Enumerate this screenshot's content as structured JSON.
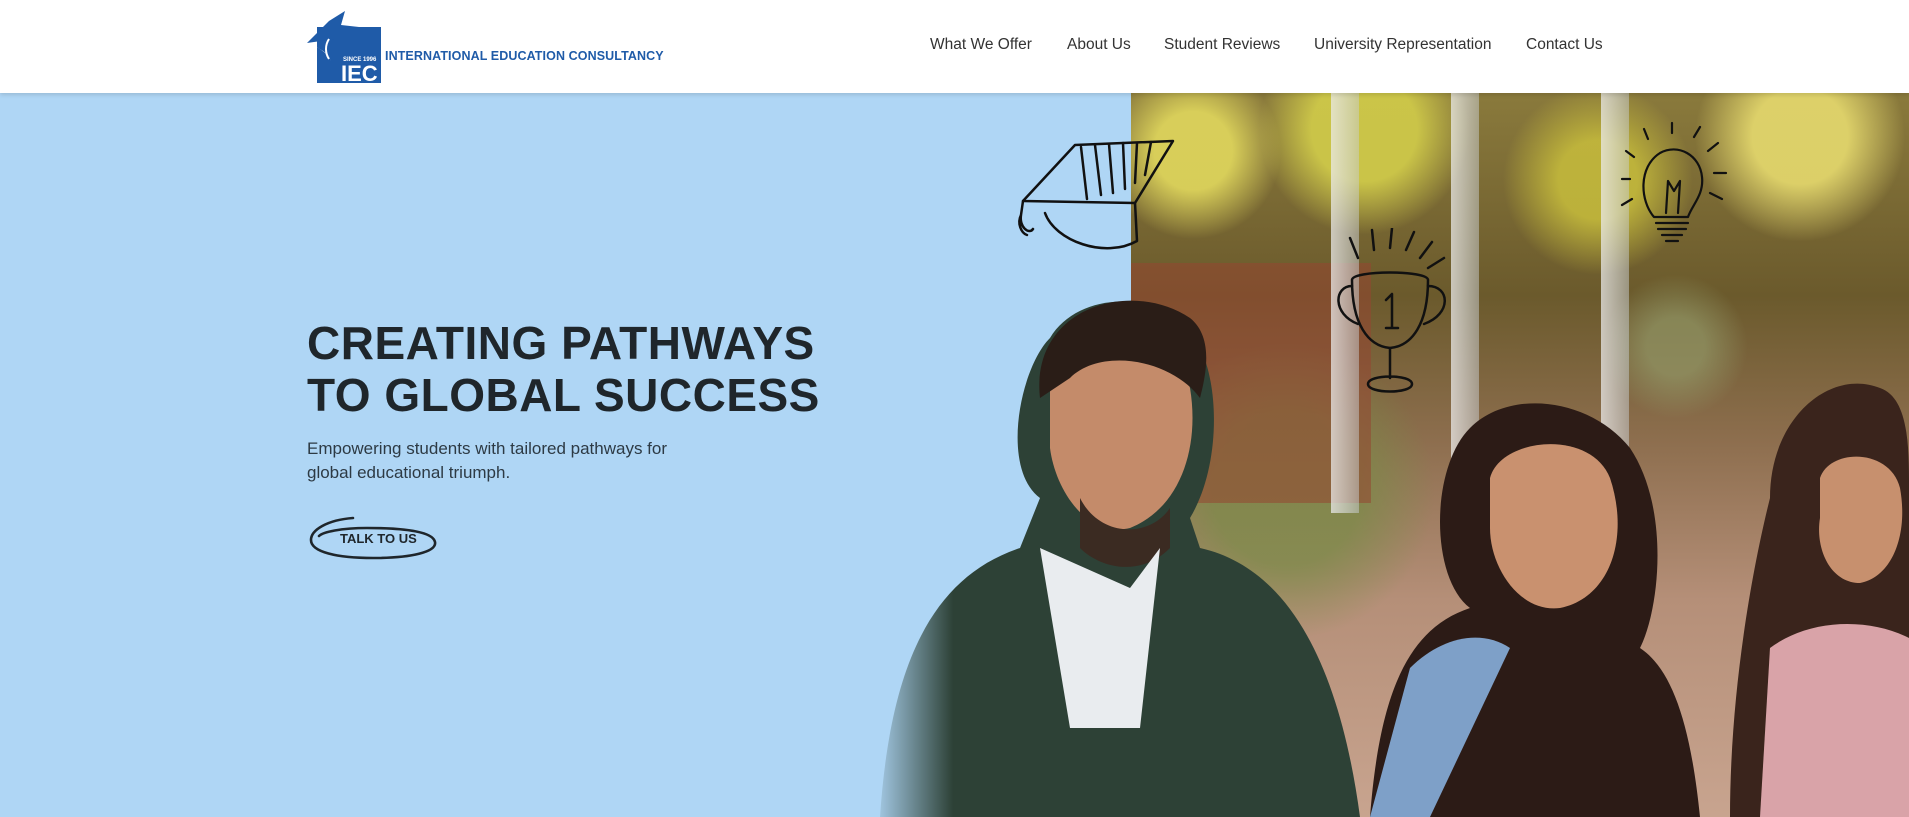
{
  "brand": {
    "since_text": "SINCE 1996",
    "monogram": "IEC",
    "name": "INTERNATIONAL EDUCATION CONSULTANCY",
    "color": "#1f5ba8"
  },
  "nav": {
    "items": [
      {
        "label": "What We Offer"
      },
      {
        "label": "About Us"
      },
      {
        "label": "Student Reviews"
      },
      {
        "label": "University Representation"
      },
      {
        "label": "Contact Us"
      }
    ]
  },
  "hero": {
    "headline_line1": "CREATING PATHWAYS",
    "headline_line2": "TO GLOBAL SUCCESS",
    "subtitle": "Empowering students with tailored pathways for global educational triumph.",
    "cta_label": "TALK TO US",
    "background_color": "#afd6f5",
    "doodles": [
      "graduation-cap-icon",
      "trophy-icon",
      "light-bulb-icon"
    ]
  }
}
